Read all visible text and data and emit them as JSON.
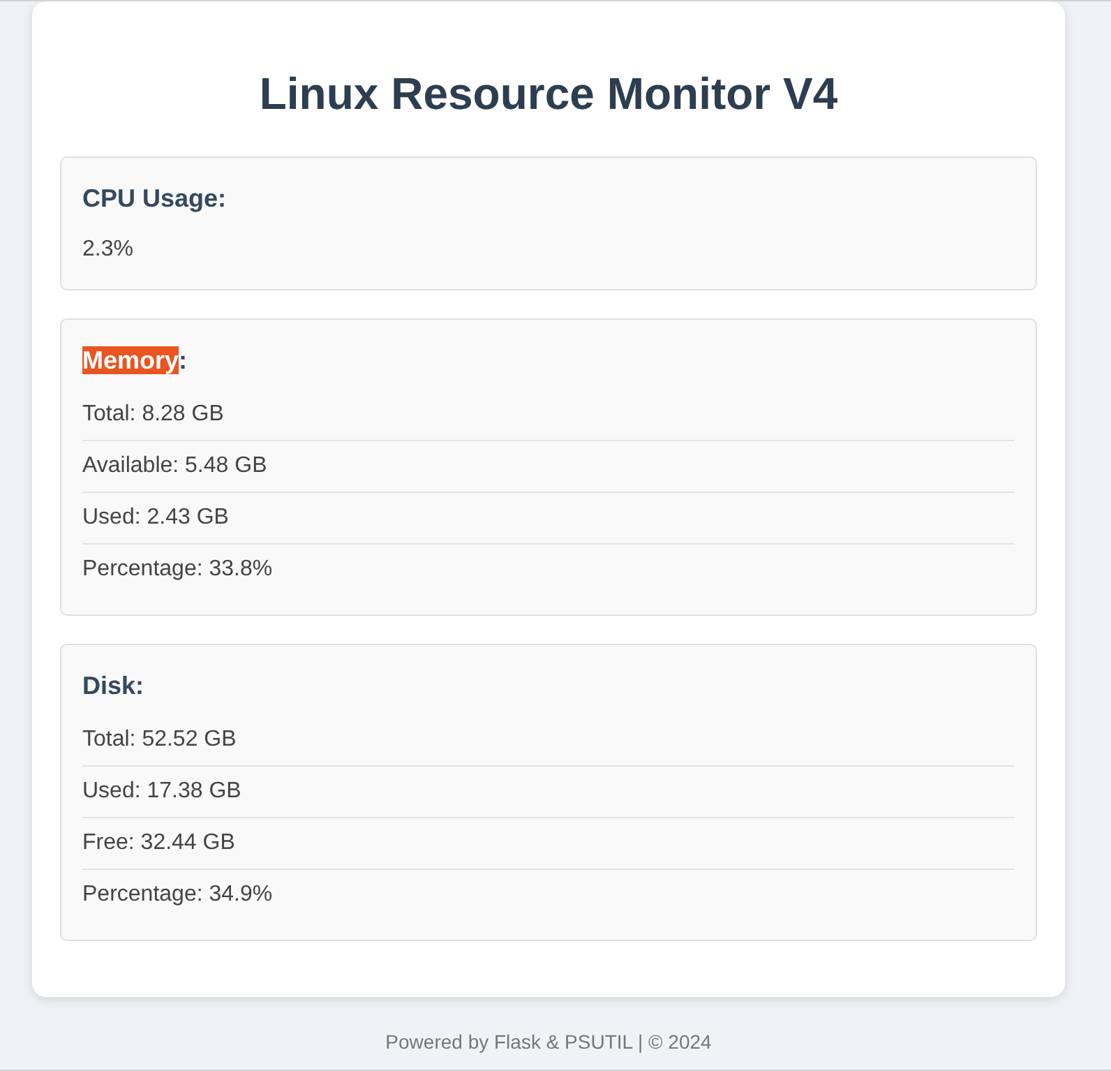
{
  "page": {
    "title": "Linux Resource Monitor V4"
  },
  "sections": [
    {
      "kind": "value",
      "heading_parts": [
        {
          "text": "CPU Usage:",
          "highlighted": false
        }
      ],
      "value": "2.3%"
    },
    {
      "kind": "list",
      "heading_parts": [
        {
          "text": "Memory",
          "highlighted": true
        },
        {
          "text": ":",
          "highlighted": false
        }
      ],
      "rows": [
        "Total: 8.28 GB",
        "Available: 5.48 GB",
        "Used: 2.43 GB",
        "Percentage: 33.8%"
      ]
    },
    {
      "kind": "list",
      "heading_parts": [
        {
          "text": "Disk:",
          "highlighted": false
        }
      ],
      "rows": [
        "Total: 52.52 GB",
        "Used: 17.38 GB",
        "Free: 32.44 GB",
        "Percentage: 34.9%"
      ]
    }
  ],
  "footer": {
    "text": "Powered by Flask & PSUTIL | © 2024"
  }
}
